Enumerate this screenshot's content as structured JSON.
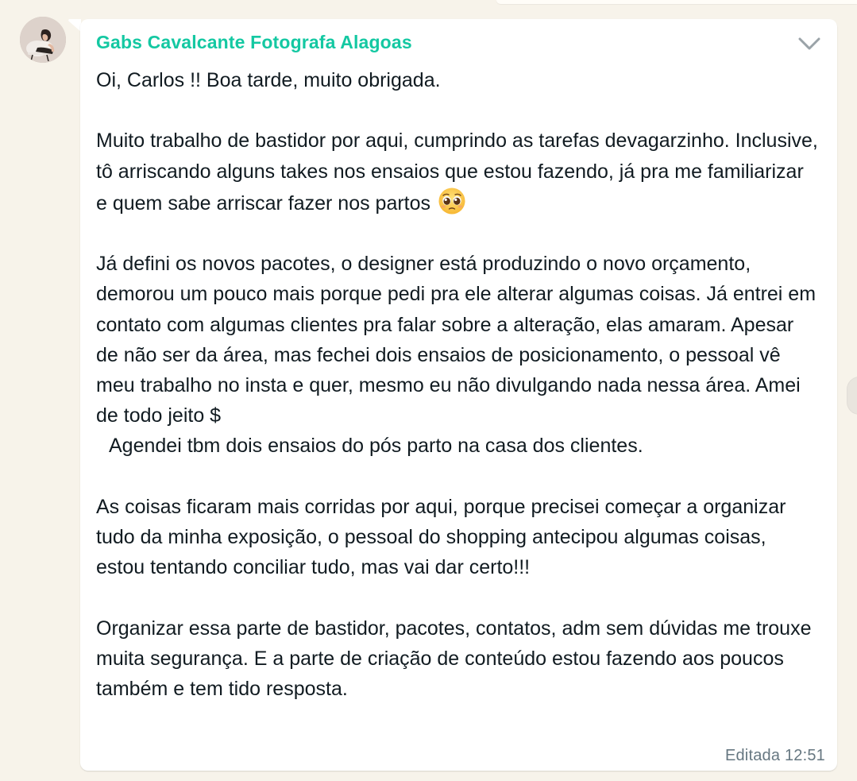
{
  "chat": {
    "sender_name": "Gabs Cavalcante Fotografa Alagoas",
    "message": {
      "paragraphs": [
        "Oi, Carlos !! Boa tarde, muito obrigada.",
        "",
        "Muito trabalho de bastidor por aqui, cumprindo as tarefas devagarzinho. Inclusive, tô arriscando alguns takes nos ensaios que estou fazendo, já pra me familiarizar e quem sabe arriscar fazer nos partos",
        "",
        "Já defini os novos pacotes, o designer está produzindo o novo orçamento, demorou um pouco mais porque pedi pra ele alterar algumas coisas. Já entrei em contato com algumas clientes pra falar sobre a alteração, elas amaram. Apesar de não ser da área, mas fechei dois ensaios de posicionamento, o pessoal vê meu trabalho no insta e quer, mesmo eu não divulgando nada nessa área. Amei de todo jeito $",
        "Agendei tbm dois ensaios do pós parto na casa dos clientes.",
        "",
        "As coisas ficaram mais corridas por aqui, porque precisei começar a organizar tudo da minha exposição, o pessoal do shopping antecipou algumas coisas, estou tentando conciliar tudo, mas vai dar certo!!!",
        "",
        "Organizar essa parte de bastidor, pacotes, contatos, adm sem dúvidas me trouxe muita segurança. E a parte de criação de conteúdo estou fazendo aos poucos também e tem tido resposta."
      ],
      "emoji": "pleading-face-emoji",
      "edited_label": "Editada",
      "time": "12:51"
    },
    "icons": {
      "menu": "chevron-down-icon",
      "avatar": "avatar-photo"
    },
    "colors": {
      "sender_name": "#14c8a2",
      "bubble": "#ffffff",
      "background": "#f7f3ea",
      "meta_text": "#667781"
    }
  }
}
